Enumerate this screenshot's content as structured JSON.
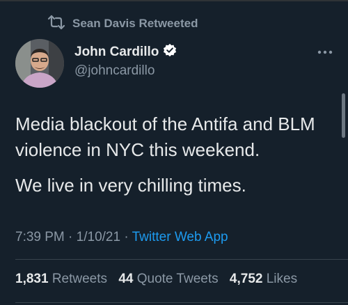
{
  "retweet": {
    "label": "Sean Davis Retweeted",
    "icon": "retweet-icon"
  },
  "author": {
    "display_name": "John Cardillo",
    "handle": "@johncardillo",
    "verified": true
  },
  "tweet": {
    "lines": [
      "Media blackout of the Antifa and BLM violence in NYC this weekend.",
      "We live in very chilling times."
    ]
  },
  "meta": {
    "time": "7:39 PM",
    "separator": "·",
    "date": "1/10/21",
    "source": "Twitter Web App"
  },
  "stats": {
    "retweets_count": "1,831",
    "retweets_label": "Retweets",
    "quotes_count": "44",
    "quotes_label": "Quote Tweets",
    "likes_count": "4,752",
    "likes_label": "Likes"
  },
  "colors": {
    "background": "#15202b",
    "text": "#e7e9ea",
    "muted": "#8b98a5",
    "link": "#1d9bf0",
    "verified": "#ffffff"
  }
}
